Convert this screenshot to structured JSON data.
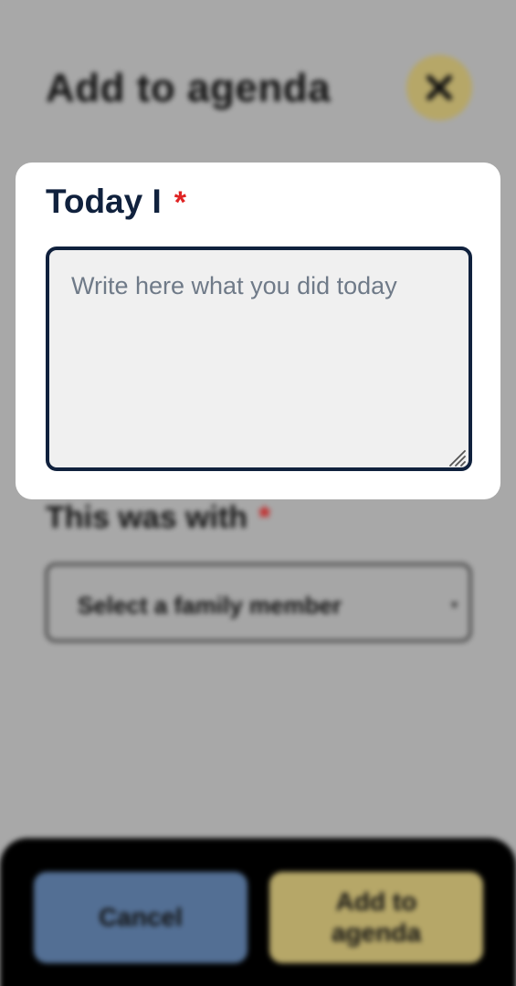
{
  "header": {
    "title": "Add to agenda",
    "close_icon": "close-icon"
  },
  "form": {
    "today_label": "Today I",
    "today_required": "*",
    "today_placeholder": "Write here what you did today",
    "today_value": "",
    "with_label": "This was with",
    "with_required": "*",
    "with_select_value": "Select a family member"
  },
  "footer": {
    "cancel_label": "Cancel",
    "add_label": "Add to agenda"
  },
  "colors": {
    "navy": "#10213d",
    "required": "#e02424",
    "gold": "#b6a768",
    "blue": "#536f94",
    "overlay": "#a8a8a8"
  }
}
